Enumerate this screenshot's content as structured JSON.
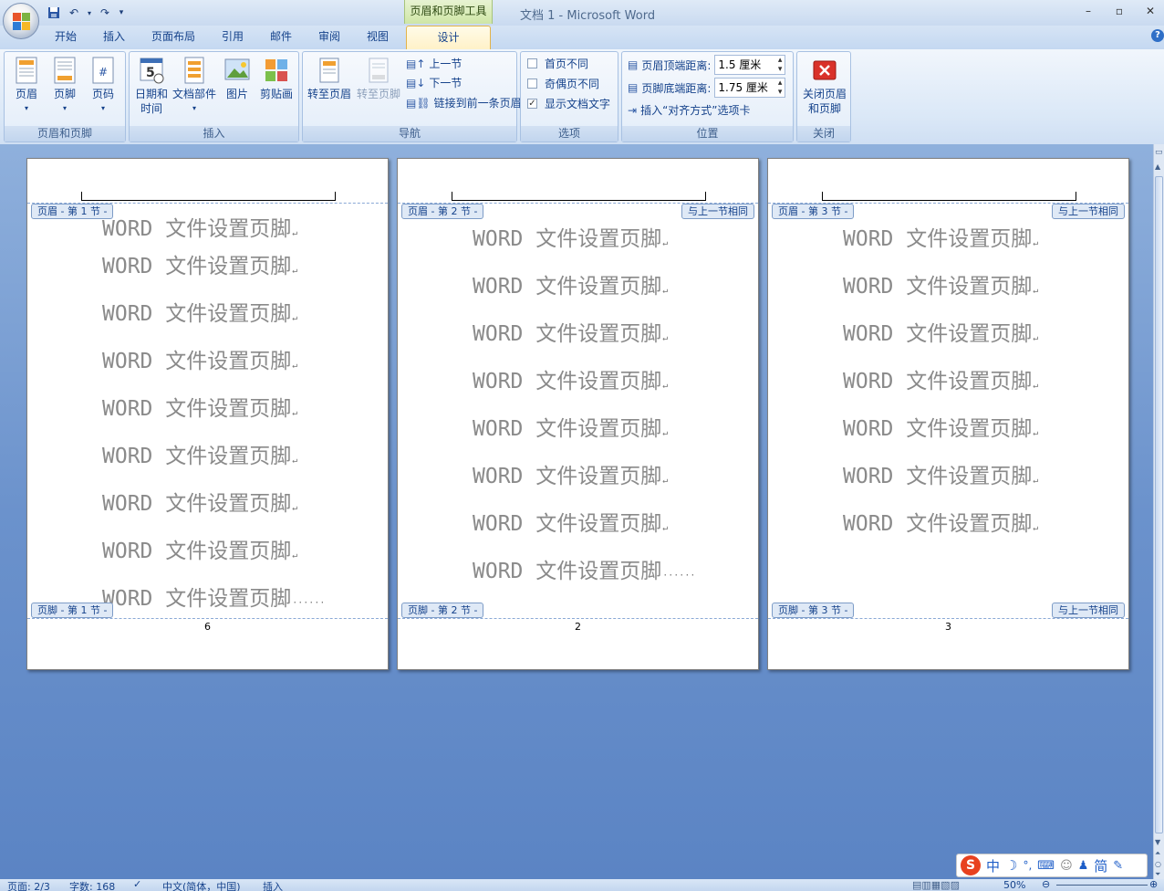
{
  "window": {
    "title": "文档 1 - Microsoft Word",
    "context_tab_group": "页眉和页脚工具",
    "controls": [
      "–",
      "▫",
      "✕"
    ]
  },
  "tabs": [
    "开始",
    "插入",
    "页面布局",
    "引用",
    "邮件",
    "审阅",
    "视图"
  ],
  "active_tab": "设计",
  "ribbon": {
    "groups": {
      "header_footer": {
        "name": "页眉和页脚",
        "buttons": [
          "页眉",
          "页脚",
          "页码"
        ]
      },
      "insert": {
        "name": "插入",
        "buttons": [
          "日期和",
          "时间",
          "文档部件",
          "图片",
          "剪贴画"
        ]
      },
      "nav": {
        "name": "导航",
        "goto_header": "转至页眉",
        "goto_footer": "转至页脚",
        "prev": "上一节",
        "next": "下一节",
        "link_prev": "链接到前一条页眉"
      },
      "options": {
        "name": "选项",
        "first_page": "首页不同",
        "odd_even": "奇偶页不同",
        "show_text": "显示文档文字",
        "first_page_checked": "",
        "odd_even_checked": "",
        "show_text_checked": "✓"
      },
      "position": {
        "name": "位置",
        "header_dist_label": "页眉顶端距离:",
        "header_dist": "1.5 厘米",
        "footer_dist_label": "页脚底端距离:",
        "footer_dist": "1.75 厘米",
        "insert_align": "插入“对齐方式”选项卡"
      },
      "close": {
        "name": "关闭",
        "btn1": "关闭页眉",
        "btn2": "和页脚"
      }
    }
  },
  "pages": [
    {
      "header_tag": "页眉 - 第 1 节 -",
      "footer_tag": "页脚 - 第 1 节 -",
      "same_prev_header": "",
      "same_prev_footer": "",
      "page_number": "6",
      "lines": [
        "WORD 文件设置页脚",
        "WORD 文件设置页脚",
        "WORD 文件设置页脚",
        "WORD 文件设置页脚",
        "WORD 文件设置页脚",
        "WORD 文件设置页脚",
        "WORD 文件设置页脚",
        "WORD 文件设置页脚",
        "WORD 文件设置页脚"
      ]
    },
    {
      "header_tag": "页眉 - 第 2 节 -",
      "footer_tag": "页脚 - 第 2 节 -",
      "same_prev_header": "与上一节相同",
      "same_prev_footer": "",
      "page_number": "2",
      "lines": [
        "WORD 文件设置页脚",
        "WORD 文件设置页脚",
        "WORD 文件设置页脚",
        "WORD 文件设置页脚",
        "WORD 文件设置页脚",
        "WORD 文件设置页脚",
        "WORD 文件设置页脚",
        "WORD 文件设置页脚"
      ]
    },
    {
      "header_tag": "页眉 - 第 3 节 -",
      "footer_tag": "页脚 - 第 3 节 -",
      "same_prev_header": "与上一节相同",
      "same_prev_footer": "与上一节相同",
      "page_number": "3",
      "lines": [
        "WORD 文件设置页脚",
        "WORD 文件设置页脚",
        "WORD 文件设置页脚",
        "WORD 文件设置页脚",
        "WORD 文件设置页脚",
        "WORD 文件设置页脚",
        "WORD 文件设置页脚"
      ]
    }
  ],
  "status": {
    "page": "页面: 2/3",
    "words": "字数: 168",
    "lang": "中文(简体，中国)",
    "mode": "插入",
    "zoom": "50%"
  },
  "ime": {
    "items": [
      "中",
      "简"
    ]
  },
  "colors": {
    "accent": "#15428b",
    "doc_bg": "#6b92cc",
    "context_tab": "#cfe6a6"
  }
}
